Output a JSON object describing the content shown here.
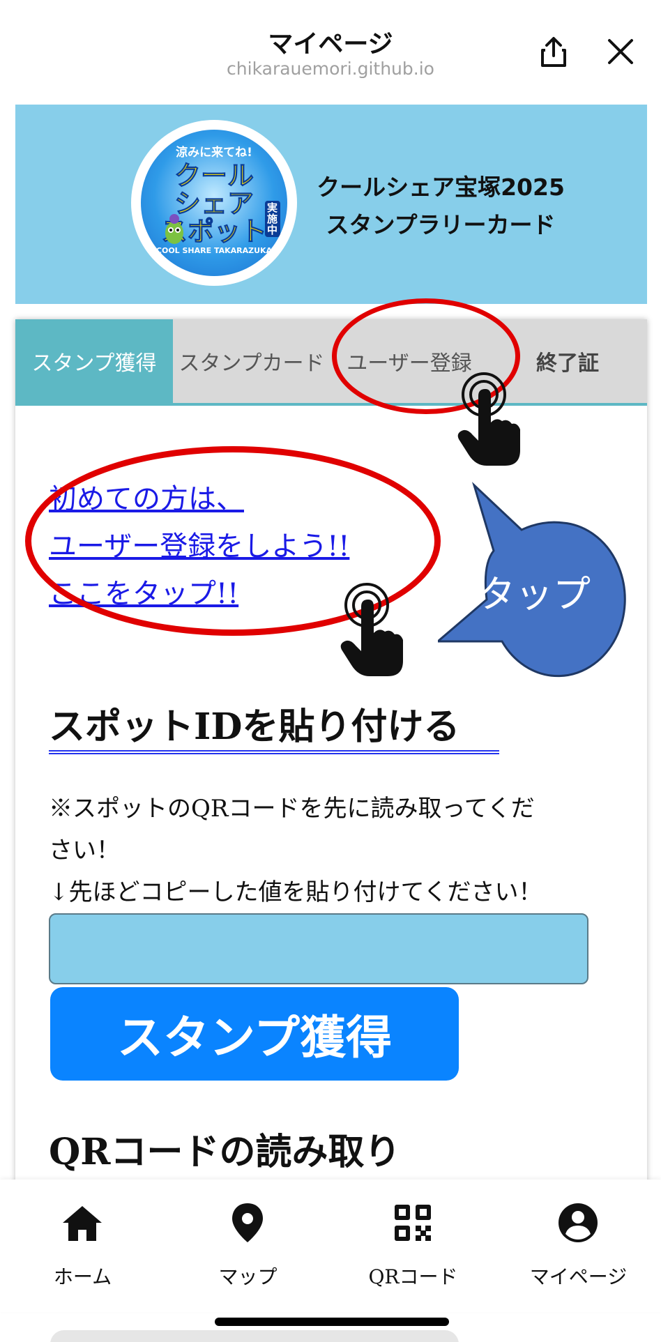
{
  "topbar": {
    "title": "マイページ",
    "url": "chikarauemori.github.io"
  },
  "banner": {
    "badge": {
      "top": "涼みに来てね!",
      "main": "クール\nシェア\nスポット",
      "side": "実施中",
      "bottom": "COOL SHARE TAKARAZUKA"
    },
    "title_line1": "クールシェア宝塚2025",
    "title_line2": "スタンプラリーカード"
  },
  "tabs": [
    {
      "label": "スタンプ獲得",
      "active": true
    },
    {
      "label": "スタンプカード",
      "active": false
    },
    {
      "label": "ユーザー登録",
      "active": false
    },
    {
      "label": "終了証",
      "active": false
    }
  ],
  "intro": {
    "line1": "初めての方は、",
    "line2": "ユーザー登録をしよう!!",
    "line3": "ここをタップ!!"
  },
  "callout": {
    "text": "タップ"
  },
  "spot_section": {
    "heading": "スポットIDを貼り付ける",
    "note_line1": "※スポットのQRコードを先に読み取ってくだ",
    "note_line2": "さい！",
    "note_line3": "↓先ほどコピーした値を貼り付けてください！",
    "input_value": "",
    "button_label": "スタンプ獲得"
  },
  "qr_section": {
    "heading": "QRコードの読み取り"
  },
  "bottom_nav": [
    {
      "label": "ホーム",
      "icon": "home-icon"
    },
    {
      "label": "マップ",
      "icon": "map-pin-icon"
    },
    {
      "label": "QRコード",
      "icon": "qr-code-icon"
    },
    {
      "label": "マイページ",
      "icon": "account-icon"
    }
  ],
  "colors": {
    "banner_bg": "#87ceea",
    "tab_active": "#5db8c4",
    "tab_inactive": "#d9d9d9",
    "link": "#1a1ae6",
    "button": "#0a84ff",
    "highlight_ring": "#e00000",
    "callout": "#4472c4"
  }
}
